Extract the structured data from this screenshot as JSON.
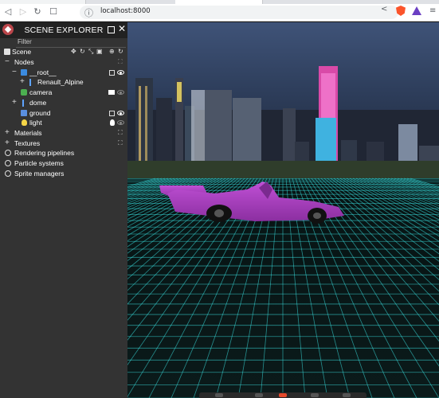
{
  "browser": {
    "url": "localhost:8000"
  },
  "explorer": {
    "title": "SCENE EXPLORER",
    "filter_placeholder": "Filter",
    "scene_label": "Scene",
    "nodes_label": "Nodes",
    "tree": [
      {
        "label": "__root__",
        "icon": "cube-icon"
      },
      {
        "label": "Renault_Alpine",
        "icon": "bone-icon"
      },
      {
        "label": "camera",
        "icon": "camera-icon"
      },
      {
        "label": "dome",
        "icon": "bone-icon"
      },
      {
        "label": "ground",
        "icon": "mesh-icon"
      },
      {
        "label": "light",
        "icon": "bulb-icon"
      }
    ],
    "sections": [
      "Materials",
      "Textures",
      "Rendering pipelines",
      "Particle systems",
      "Sprite managers"
    ]
  },
  "colors": {
    "car": "#b03fc7",
    "grid": "#3ef0f0",
    "panel": "#333333"
  }
}
